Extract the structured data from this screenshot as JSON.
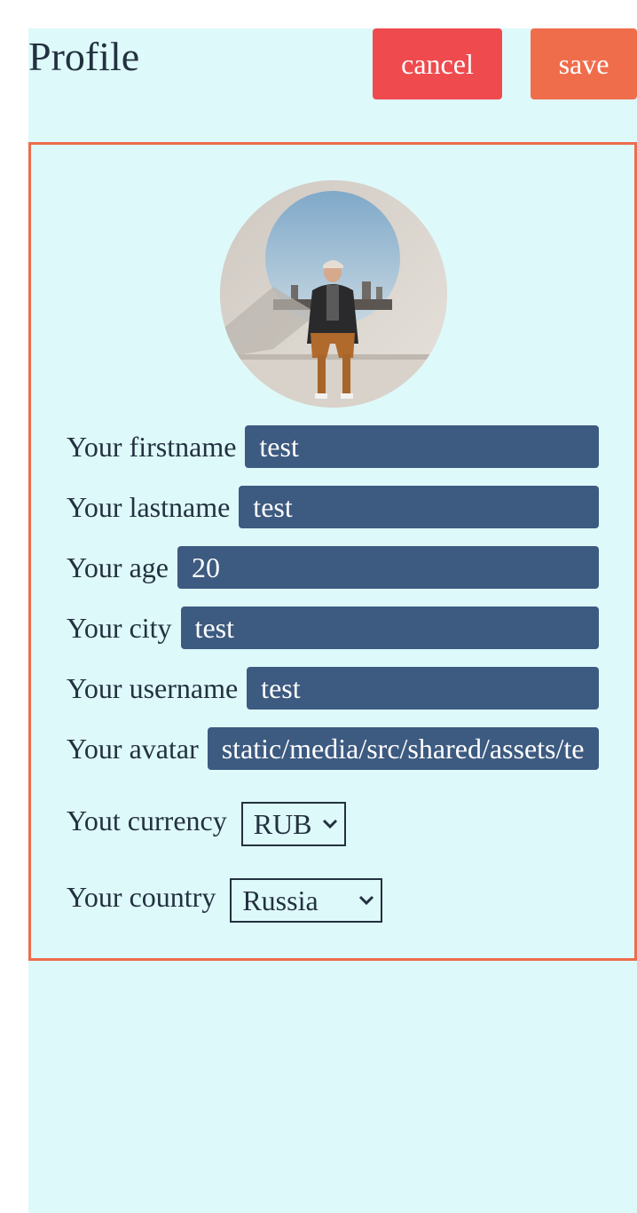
{
  "header": {
    "title": "Profile",
    "cancel_label": "cancel",
    "save_label": "save"
  },
  "colors": {
    "background": "#def9fa",
    "accent_border": "#ee6c4d",
    "cancel": "#ef4b4f",
    "save": "#f06d4c",
    "input_bg": "#3d5a80",
    "text": "#22313f"
  },
  "form": {
    "firstname": {
      "label": "Your firstname",
      "value": "test"
    },
    "lastname": {
      "label": "Your lastname",
      "value": "test"
    },
    "age": {
      "label": "Your age",
      "value": "20"
    },
    "city": {
      "label": "Your city",
      "value": "test"
    },
    "username": {
      "label": "Your username",
      "value": "test"
    },
    "avatar": {
      "label": "Your avatar",
      "value": "static/media/src/shared/assets/te"
    },
    "currency": {
      "label": "Yout currency",
      "selected": "RUB"
    },
    "country": {
      "label": "Your country",
      "selected": "Russia"
    }
  }
}
